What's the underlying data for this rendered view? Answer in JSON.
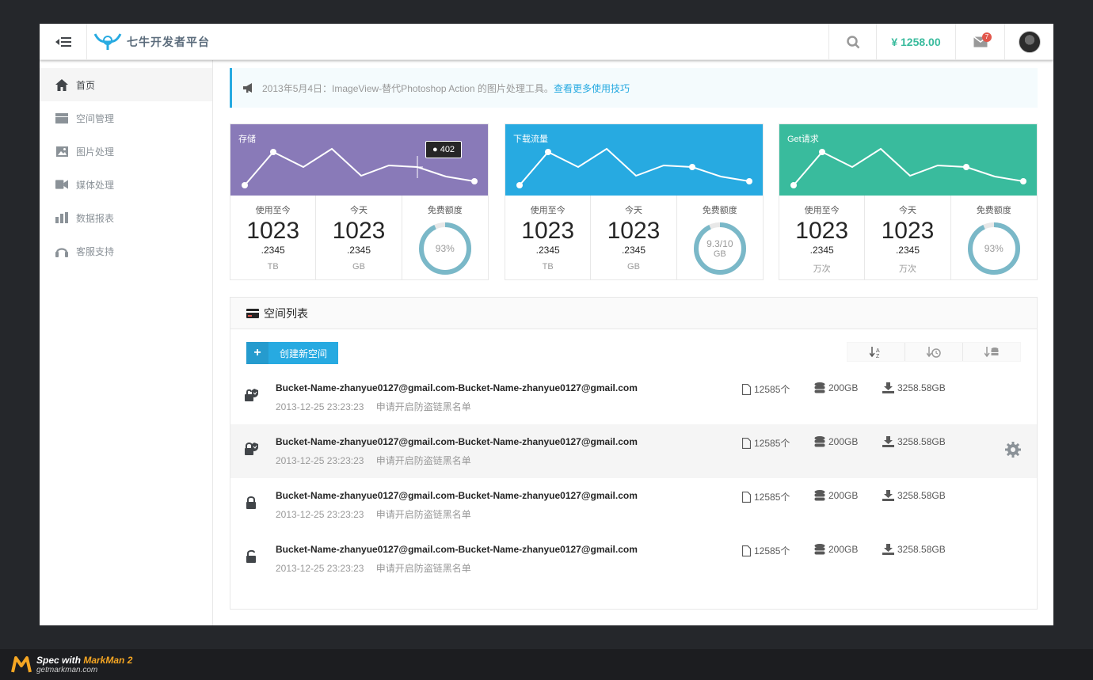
{
  "header": {
    "logo_text": "七牛开发者平台",
    "balance": "¥ 1258.00",
    "mail_badge": "7"
  },
  "sidebar": {
    "items": [
      {
        "label": "首页",
        "icon": "home-icon",
        "active": true
      },
      {
        "label": "空间管理",
        "icon": "storage-icon",
        "active": false
      },
      {
        "label": "图片处理",
        "icon": "image-icon",
        "active": false
      },
      {
        "label": "媒体处理",
        "icon": "video-icon",
        "active": false
      },
      {
        "label": "数据报表",
        "icon": "bar-chart-icon",
        "active": false
      },
      {
        "label": "客服支持",
        "icon": "headset-icon",
        "active": false
      }
    ]
  },
  "notice": {
    "text": "2013年5月4日：ImageView-替代Photoshop Action 的图片处理工具。",
    "link": "查看更多使用技巧"
  },
  "cards": [
    {
      "title": "存储",
      "color": "#897ab8",
      "tooltip": "● 402",
      "stats": [
        {
          "label": "使用至今",
          "big": "1023",
          "dec": ".2345",
          "unit": "TB"
        },
        {
          "label": "今天",
          "big": "1023",
          "dec": ".2345",
          "unit": "GB"
        },
        {
          "label": "免费额度",
          "ring": "93%",
          "ring_unit": ""
        }
      ]
    },
    {
      "title": "下载流量",
      "color": "#27aae1",
      "stats": [
        {
          "label": "使用至今",
          "big": "1023",
          "dec": ".2345",
          "unit": "TB"
        },
        {
          "label": "今天",
          "big": "1023",
          "dec": ".2345",
          "unit": "GB"
        },
        {
          "label": "免费额度",
          "ring": "9.3/10",
          "ring_unit": "GB"
        }
      ]
    },
    {
      "title": "Get请求",
      "color": "#39bb9d",
      "stats": [
        {
          "label": "使用至今",
          "big": "1023",
          "dec": ".2345",
          "unit": "万次"
        },
        {
          "label": "今天",
          "big": "1023",
          "dec": ".2345",
          "unit": "万次"
        },
        {
          "label": "免费额度",
          "ring": "93%",
          "ring_unit": ""
        }
      ]
    }
  ],
  "panel": {
    "title": "空间列表",
    "create_label": "创建新空间",
    "rows": [
      {
        "name": "Bucket-Name-zhanyue0127@gmail.com-Bucket-Name-zhanyue0127@gmail.com",
        "date": "2013-12-25 23:23:23",
        "note": "申请开启防盗链黑名单",
        "files": "12585个",
        "size": "200GB",
        "traffic": "3258.58GB",
        "lock": "shield-unlock-icon"
      },
      {
        "name": "Bucket-Name-zhanyue0127@gmail.com-Bucket-Name-zhanyue0127@gmail.com",
        "date": "2013-12-25 23:23:23",
        "note": "申请开启防盗链黑名单",
        "files": "12585个",
        "size": "200GB",
        "traffic": "3258.58GB",
        "lock": "shield-lock-icon"
      },
      {
        "name": "Bucket-Name-zhanyue0127@gmail.com-Bucket-Name-zhanyue0127@gmail.com",
        "date": "2013-12-25 23:23:23",
        "note": "申请开启防盗链黑名单",
        "files": "12585个",
        "size": "200GB",
        "traffic": "3258.58GB",
        "lock": "lock-icon"
      },
      {
        "name": "Bucket-Name-zhanyue0127@gmail.com-Bucket-Name-zhanyue0127@gmail.com",
        "date": "2013-12-25 23:23:23",
        "note": "申请开启防盗链黑名单",
        "files": "12585个",
        "size": "200GB",
        "traffic": "3258.58GB",
        "lock": "unlock-icon"
      }
    ]
  },
  "footer": {
    "spec_with": "Spec with ",
    "brand": "MarkMan 2",
    "site": "getmarkman.com"
  }
}
